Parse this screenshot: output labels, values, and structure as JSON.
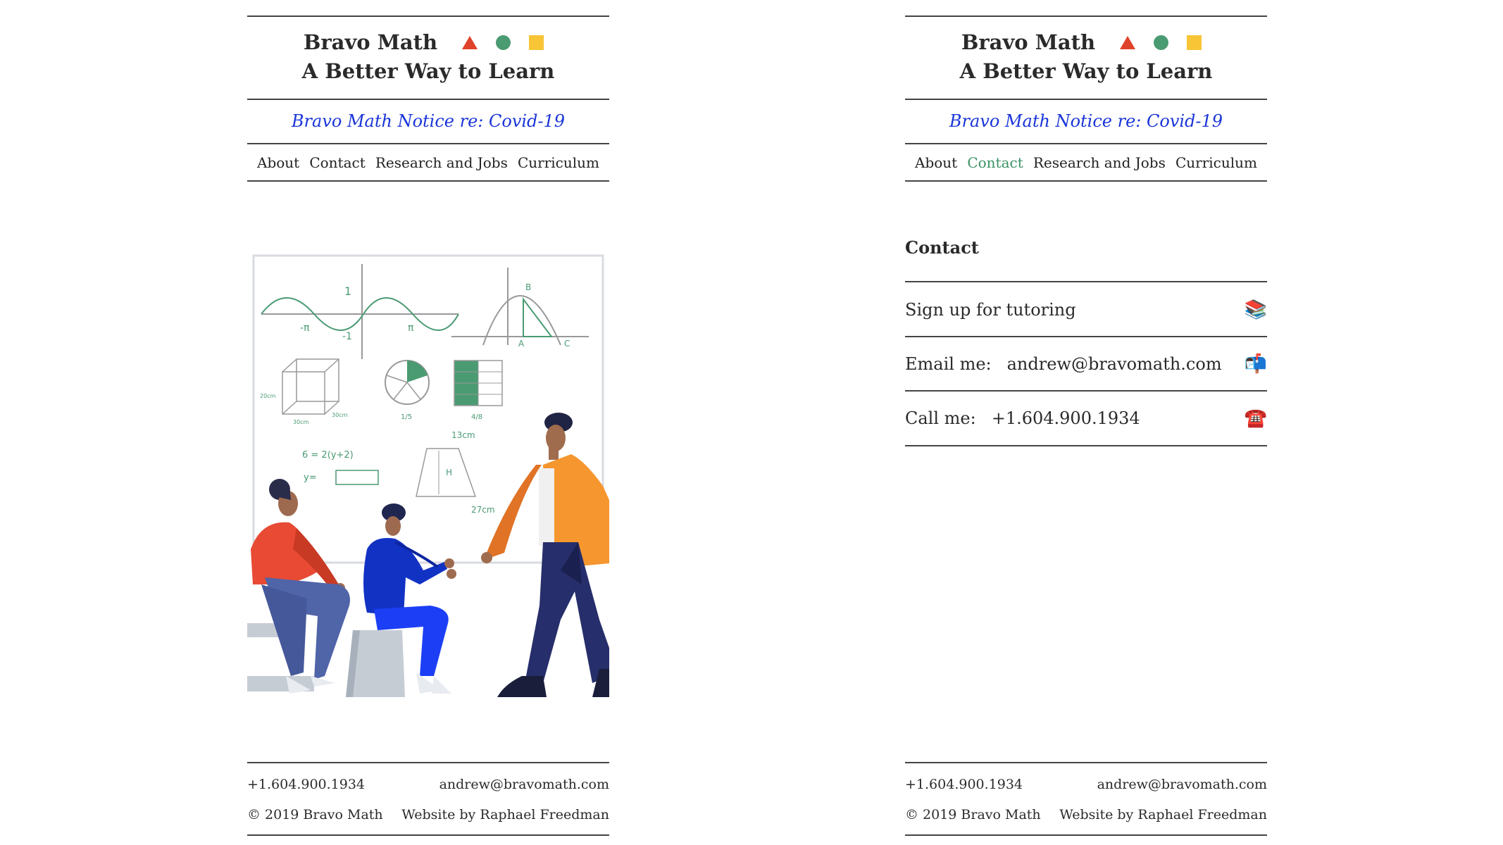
{
  "left": {
    "brand": {
      "name": "Bravo Math",
      "tagline": "A Better Way to Learn"
    },
    "notice": "Bravo Math Notice re: Covid-19",
    "nav": [
      "About",
      "Contact",
      "Research and Jobs",
      "Curriculum"
    ],
    "illustration": {
      "wave_labels": [
        "1",
        "-π",
        "-1",
        "π"
      ],
      "triangle_labels": [
        "B",
        "A",
        "C"
      ],
      "cube_labels": [
        "20cm",
        "30cm",
        "30cm"
      ],
      "pie_label": "1/5",
      "grid_label": "4/8",
      "equation": "6 = 2(y+2)",
      "y_label": "y=",
      "trap_top": "13cm",
      "trap_h": "H",
      "trap_bottom": "27cm"
    },
    "footer": {
      "phone": "+1.604.900.1934",
      "email": "andrew@bravomath.com",
      "copyright": "© 2019 Bravo Math",
      "credit": "Website by Raphael Freedman"
    }
  },
  "right": {
    "brand": {
      "name": "Bravo Math",
      "tagline": "A Better Way to Learn"
    },
    "notice": "Bravo Math Notice re: Covid-19",
    "nav": [
      "About",
      "Contact",
      "Research and Jobs",
      "Curriculum"
    ],
    "active_nav": "Contact",
    "contact": {
      "title": "Contact",
      "signup": "Sign up for tutoring",
      "email_label": "Email me:",
      "email": "andrew@bravomath.com",
      "call_label": "Call me:",
      "phone": "+1.604.900.1934",
      "icons": [
        "books-icon",
        "mailbox-icon",
        "telephone-icon"
      ]
    },
    "footer": {
      "phone": "+1.604.900.1934",
      "email": "andrew@bravomath.com",
      "copyright": "© 2019 Bravo Math",
      "credit": "Website by Raphael Freedman"
    }
  },
  "colors": {
    "triangle": "#e0432b",
    "circle": "#4a9a72",
    "square": "#f7c535",
    "notice": "#1a35d8",
    "active_nav": "#3a9164"
  }
}
